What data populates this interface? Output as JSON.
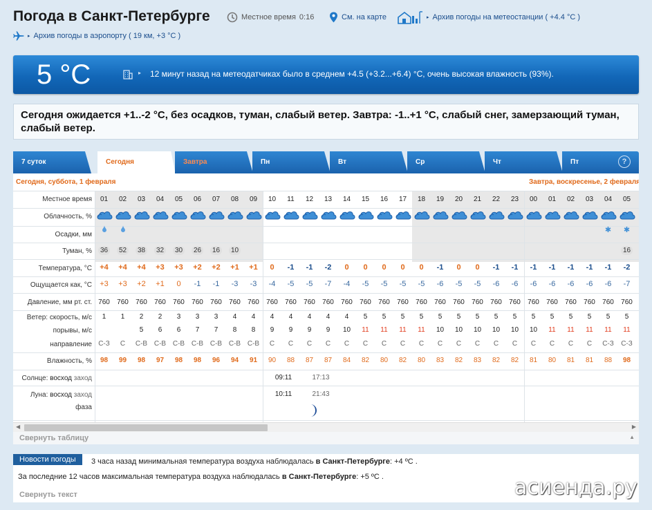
{
  "header": {
    "title": "Погода в Санкт-Петербурге",
    "local_time_label": "Местное время",
    "local_time_value": "0:16",
    "map_link": "См. на карте",
    "archive_station": "Архив погоды на метеостанции ( +4.4 °C )",
    "archive_airport": "Архив погоды в аэропорту ( 19 км, +3 °C )"
  },
  "now": {
    "temp": "5 °C",
    "text": "12 минут назад на метеодатчиках было в среднем +4.5 (+3.2...+6.4) °C, очень высокая влажность (93%)."
  },
  "forecast_text": "Сегодня ожидается +1..-2 °C, без осадков, туман, слабый ветер. Завтра: -1..+1 °C, слабый снег, замерзающий туман, слабый ветер.",
  "tabs": [
    {
      "label": "7 суток"
    },
    {
      "label": "Сегодня"
    },
    {
      "label": "Завтра"
    },
    {
      "label": "Пн"
    },
    {
      "label": "Вт"
    },
    {
      "label": "Ср"
    },
    {
      "label": "Чт"
    },
    {
      "label": "Пт"
    }
  ],
  "help_label": "?",
  "day_heads": [
    "Сегодня, суббота, 1 февраля",
    "Завтра, воскресенье, 2 февраля"
  ],
  "row_labels": {
    "time": "Местное время",
    "cloud": "Облачность, %",
    "precip": "Осадки, мм",
    "fog": "Туман, %",
    "temp": "Температура, °C",
    "feels": "Ощущается как, °C",
    "pressure": "Давление, мм рт. ст.",
    "wind_speed": "Ветер: скорость, м/с",
    "gusts": "порывы, м/с",
    "direction": "направление",
    "humidity": "Влажность, %",
    "sun_a": "Солнце:",
    "sun_b": "восход",
    "sun_c": "заход",
    "moon_a": "Луна:",
    "moon_b": "восход",
    "moon_c": "заход",
    "moon_phase": "фаза"
  },
  "hours": [
    "01",
    "02",
    "03",
    "04",
    "05",
    "06",
    "07",
    "08",
    "09",
    "10",
    "11",
    "12",
    "13",
    "14",
    "15",
    "16",
    "17",
    "18",
    "19",
    "20",
    "21",
    "22",
    "23",
    "00",
    "01",
    "02",
    "03",
    "04",
    "05"
  ],
  "fog": [
    "36",
    "52",
    "38",
    "32",
    "30",
    "26",
    "16",
    "10",
    "",
    "",
    "",
    "",
    "",
    "",
    "",
    "",
    "",
    "",
    "",
    "",
    "",
    "",
    "",
    "",
    "",
    "",
    "",
    "",
    "16"
  ],
  "temp": [
    "+4",
    "+4",
    "+4",
    "+3",
    "+3",
    "+2",
    "+2",
    "+1",
    "+1",
    "0",
    "-1",
    "-1",
    "-2",
    "0",
    "0",
    "0",
    "0",
    "0",
    "-1",
    "0",
    "0",
    "-1",
    "-1",
    "-1",
    "-1",
    "-1",
    "-1",
    "-1",
    "-2"
  ],
  "feels": [
    "+3",
    "+3",
    "+2",
    "+1",
    "0",
    "-1",
    "-1",
    "-3",
    "-3",
    "-4",
    "-5",
    "-5",
    "-7",
    "-4",
    "-5",
    "-5",
    "-5",
    "-5",
    "-6",
    "-5",
    "-5",
    "-6",
    "-6",
    "-6",
    "-6",
    "-6",
    "-6",
    "-6",
    "-7"
  ],
  "pressure": [
    "760",
    "760",
    "760",
    "760",
    "760",
    "760",
    "760",
    "760",
    "760",
    "760",
    "760",
    "760",
    "760",
    "760",
    "760",
    "760",
    "760",
    "760",
    "760",
    "760",
    "760",
    "760",
    "760",
    "760",
    "760",
    "760",
    "760",
    "760",
    "760"
  ],
  "wind": [
    "1",
    "1",
    "2",
    "2",
    "3",
    "3",
    "3",
    "4",
    "4",
    "4",
    "4",
    "4",
    "4",
    "4",
    "5",
    "5",
    "5",
    "5",
    "5",
    "5",
    "5",
    "5",
    "5",
    "5",
    "5",
    "5",
    "5",
    "5",
    "5"
  ],
  "gusts": [
    "",
    "",
    "5",
    "6",
    "6",
    "7",
    "7",
    "8",
    "8",
    "9",
    "9",
    "9",
    "9",
    "10",
    "11",
    "11",
    "11",
    "11",
    "10",
    "10",
    "10",
    "10",
    "10",
    "10",
    "11",
    "11",
    "11",
    "11",
    "11"
  ],
  "direction": [
    "С-З",
    "С",
    "С-В",
    "С-В",
    "С-В",
    "С-В",
    "С-В",
    "С-В",
    "С-В",
    "С",
    "С",
    "С",
    "С",
    "С",
    "С",
    "С",
    "С",
    "С",
    "С",
    "С",
    "С",
    "С",
    "С",
    "С",
    "С",
    "С",
    "С",
    "С-З",
    "С-З"
  ],
  "humidity": [
    "98",
    "99",
    "98",
    "97",
    "98",
    "98",
    "96",
    "94",
    "91",
    "90",
    "88",
    "87",
    "87",
    "84",
    "82",
    "80",
    "82",
    "80",
    "83",
    "82",
    "83",
    "82",
    "82",
    "81",
    "80",
    "81",
    "81",
    "88",
    "98"
  ],
  "sun_rise": "09:11",
  "sun_set": "17:13",
  "moon_rise": "10:11",
  "moon_set": "21:43",
  "collapse_table": "Свернуть таблицу",
  "news": {
    "badge": "Новости погоды",
    "line1_a": "3 часа назад минимальная температура воздуха наблюдалась ",
    "line1_b": "в Санкт-Петербурге",
    "line1_c": ": +4 ºC .",
    "line2_a": "За последние 12 часов максимальная температура воздуха наблюдалась ",
    "line2_b": "в Санкт-Петербурге",
    "line2_c": ": +5 ºC .",
    "collapse": "Свернуть текст"
  },
  "watermark": "асиенда.ру",
  "colors": {
    "accent_blue": "#1267b8",
    "orange": "#e06a1b",
    "cold": "#1a4d8c"
  }
}
